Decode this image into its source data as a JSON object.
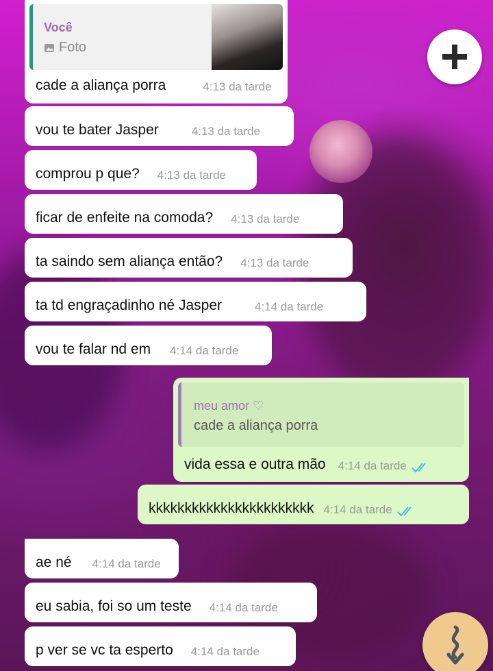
{
  "colors": {
    "incoming_bubble": "#ffffff",
    "outgoing_bubble": "#dcf8c6",
    "timestamp": "#9a9a9a",
    "read_ticks": "#4fb6ec",
    "quote_name": "#a26ab6",
    "quote_bar_incoming": "#1e9a84",
    "quote_bar_outgoing": "#a07cc0"
  },
  "icons": {
    "new_chat": "plus-icon",
    "scroll_down": "arrow-down-icon",
    "photo": "photo-icon",
    "read": "double-check-icon"
  },
  "first_message": {
    "reply_name": "Você",
    "reply_type": "Foto",
    "text": "cade a aliança porra",
    "time": "4:13 da tarde"
  },
  "messages": [
    {
      "text": "vou te bater Jasper",
      "time": "4:13 da tarde"
    },
    {
      "text": "comprou p que?",
      "time": "4:13 da tarde"
    },
    {
      "text": "ficar de enfeite na comoda?",
      "time": "4:13 da tarde"
    },
    {
      "text": "ta saindo sem aliança então?",
      "time": "4:13 da tarde"
    },
    {
      "text": "ta td engraçadinho né Jasper",
      "time": "4:14 da tarde"
    },
    {
      "text": "vou te falar nd em",
      "time": "4:14 da tarde"
    }
  ],
  "outgoing_reply": {
    "reply_name": "meu amor ♡",
    "reply_text": "cade a aliança porra",
    "text": "vida essa e outra mão",
    "time": "4:14 da tarde"
  },
  "outgoing_messages": [
    {
      "text": "kkkkkkkkkkkkkkkkkkkkkkk",
      "time": "4:14 da tarde"
    }
  ],
  "later_messages": [
    {
      "text": "ae né",
      "time": "4:14 da tarde"
    },
    {
      "text": "eu sabia, foi so um teste",
      "time": "4:14 da tarde"
    },
    {
      "text": "p ver se vc ta esperto",
      "time": "4:14 da tarde"
    }
  ]
}
